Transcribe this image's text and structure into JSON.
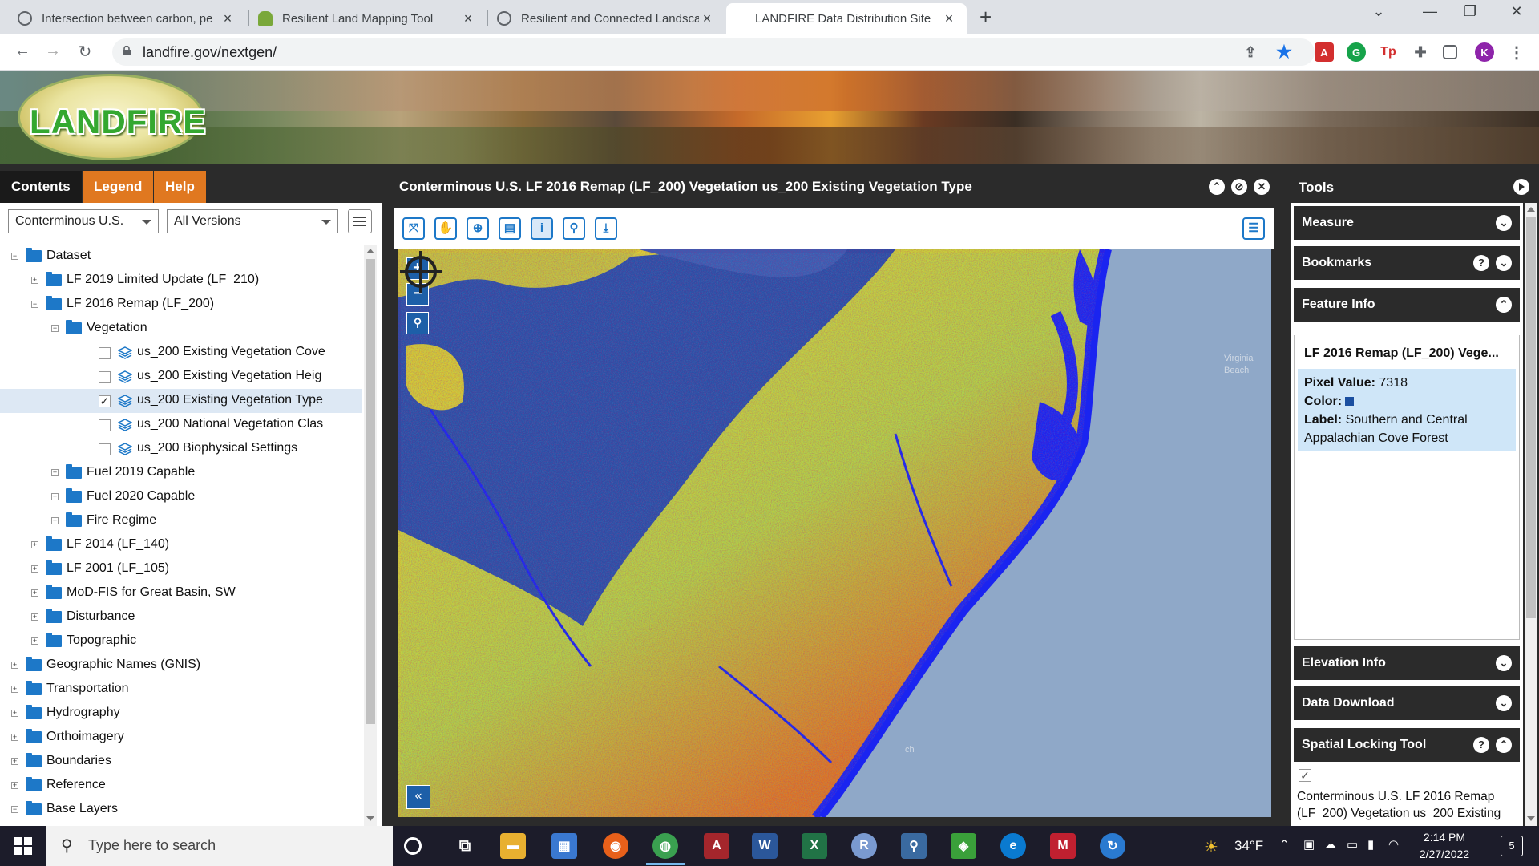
{
  "browser": {
    "tabs": [
      {
        "title": "Intersection between carbon, pe",
        "icon": "globe-icon",
        "active": false
      },
      {
        "title": "Resilient Land Mapping Tool",
        "icon": "tree-icon",
        "active": false
      },
      {
        "title": "Resilient and Connected Landsca",
        "icon": "globe-icon",
        "active": false
      },
      {
        "title": "LANDFIRE Data Distribution Site",
        "icon": "none",
        "active": true
      }
    ],
    "new_tab": "+",
    "url": "landfire.gov/nextgen/",
    "profile_initial": "K"
  },
  "banner": {
    "logo_text": "LANDFIRE"
  },
  "left_panel": {
    "tabs": [
      "Contents",
      "Legend",
      "Help"
    ],
    "extent_select": "Conterminous U.S.",
    "version_select": "All Versions",
    "tree": [
      {
        "label": "Dataset",
        "level": 0,
        "type": "folder",
        "expander": "−"
      },
      {
        "label": "LF 2019 Limited Update (LF_210)",
        "level": 1,
        "type": "folder",
        "expander": "+"
      },
      {
        "label": "LF 2016 Remap (LF_200)",
        "level": 1,
        "type": "folder",
        "expander": "−"
      },
      {
        "label": "Vegetation",
        "level": 2,
        "type": "folder",
        "expander": "−"
      },
      {
        "label": "us_200 Existing Vegetation Cove",
        "level": 3,
        "type": "layer",
        "checked": false
      },
      {
        "label": "us_200 Existing Vegetation Heig",
        "level": 3,
        "type": "layer",
        "checked": false
      },
      {
        "label": "us_200 Existing Vegetation Type",
        "level": 3,
        "type": "layer",
        "checked": true,
        "selected": true
      },
      {
        "label": "us_200 National Vegetation Clas",
        "level": 3,
        "type": "layer",
        "checked": false
      },
      {
        "label": "us_200 Biophysical Settings",
        "level": 3,
        "type": "layer",
        "checked": false
      },
      {
        "label": "Fuel 2019 Capable",
        "level": 2,
        "type": "folder",
        "expander": "+"
      },
      {
        "label": "Fuel 2020 Capable",
        "level": 2,
        "type": "folder",
        "expander": "+"
      },
      {
        "label": "Fire Regime",
        "level": 2,
        "type": "folder",
        "expander": "+"
      },
      {
        "label": "LF 2014 (LF_140)",
        "level": 1,
        "type": "folder",
        "expander": "+"
      },
      {
        "label": "LF 2001 (LF_105)",
        "level": 1,
        "type": "folder",
        "expander": "+"
      },
      {
        "label": "MoD-FIS for Great Basin, SW",
        "level": 1,
        "type": "folder",
        "expander": "+"
      },
      {
        "label": "Disturbance",
        "level": 1,
        "type": "folder",
        "expander": "+"
      },
      {
        "label": "Topographic",
        "level": 1,
        "type": "folder",
        "expander": "+"
      },
      {
        "label": "Geographic Names (GNIS)",
        "level": 0,
        "type": "folder",
        "expander": "+"
      },
      {
        "label": "Transportation",
        "level": 0,
        "type": "folder",
        "expander": "+"
      },
      {
        "label": "Hydrography",
        "level": 0,
        "type": "folder",
        "expander": "+"
      },
      {
        "label": "Orthoimagery",
        "level": 0,
        "type": "folder",
        "expander": "+"
      },
      {
        "label": "Boundaries",
        "level": 0,
        "type": "folder",
        "expander": "+"
      },
      {
        "label": "Reference",
        "level": 0,
        "type": "folder",
        "expander": "+"
      },
      {
        "label": "Base Layers",
        "level": 0,
        "type": "folder",
        "expander": "−"
      }
    ]
  },
  "map_panel": {
    "title": "Conterminous U.S. LF 2016 Remap (LF_200) Vegetation us_200 Existing Vegetation Type",
    "tools": [
      "full-extent",
      "pan",
      "zoom",
      "layers",
      "identify",
      "locate",
      "download"
    ],
    "zoom_in": "+",
    "zoom_out": "−",
    "labels": {
      "city1": "Virginia",
      "city2": "Beach",
      "city3": "ch"
    }
  },
  "tools_panel": {
    "title": "Tools",
    "measure": "Measure",
    "bookmarks": "Bookmarks",
    "feature_info": "Feature Info",
    "feature_heading": "LF 2016 Remap (LF_200) Vege...",
    "pixel_value_label": "Pixel Value:",
    "pixel_value": "7318",
    "color_label": "Color:",
    "label_label": "Label:",
    "label_value": "Southern and Central Appalachian Cove Forest",
    "elevation_info": "Elevation Info",
    "data_download": "Data Download",
    "spatial_locking": "Spatial Locking Tool",
    "spatial_text": "Conterminous U.S. LF 2016 Remap (LF_200) Vegetation us_200 Existing"
  },
  "taskbar": {
    "search_placeholder": "Type here to search",
    "temperature": "34°F",
    "time": "2:14 PM",
    "date": "2/27/2022",
    "notifications": "5"
  },
  "colors": {
    "accent_orange": "#e07820",
    "panel_dark": "#2b2b2b",
    "link_blue": "#1d78c8",
    "feature_bg": "#cfe6f8",
    "pixel_color": "#1b4fa0"
  }
}
